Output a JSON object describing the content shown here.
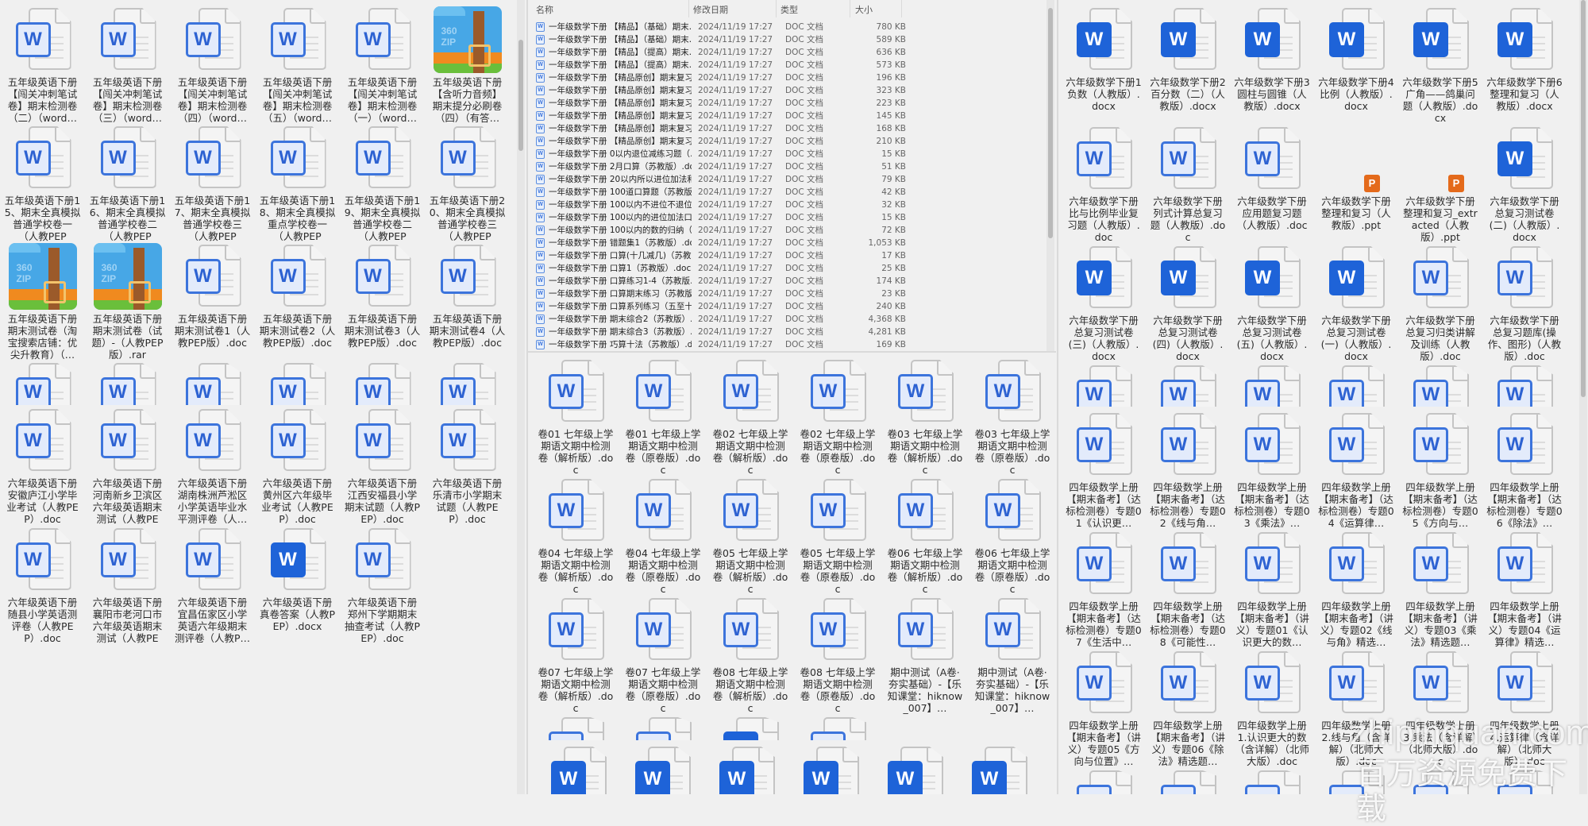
{
  "windows": {
    "left_top": [
      {
        "label": "五年级英语下册【闯关冲刺笔试卷】期末检测卷（二）（word…",
        "icon": "doc"
      },
      {
        "label": "五年级英语下册【闯关冲刺笔试卷】期末检测卷（三）（word…",
        "icon": "doc"
      },
      {
        "label": "五年级英语下册【闯关冲刺笔试卷】期末检测卷（四）（word…",
        "icon": "doc"
      },
      {
        "label": "五年级英语下册【闯关冲刺笔试卷】期末检测卷（五）（word…",
        "icon": "doc"
      },
      {
        "label": "五年级英语下册【闯关冲刺笔试卷】期末检测卷（一）（word…",
        "icon": "doc"
      },
      {
        "label": "五年级英语下册【含听力音频】期末提分必刷卷（四）（有答…",
        "icon": "zip"
      },
      {
        "label": "五年级英语下册15、期末全真模拟普通学校卷一（人教PEP版）…",
        "icon": "doc"
      },
      {
        "label": "五年级英语下册16、期末全真模拟普通学校卷二（人教PEP版）…",
        "icon": "doc"
      },
      {
        "label": "五年级英语下册17、期末全真模拟普通学校卷三（人教PEP版）…",
        "icon": "doc"
      },
      {
        "label": "五年级英语下册18、期末全真模拟重点学校卷一（人教PEP版）…",
        "icon": "doc"
      },
      {
        "label": "五年级英语下册19、期末全真模拟普通学校卷二（人教PEP版）…",
        "icon": "doc"
      },
      {
        "label": "五年级英语下册20、期末全真模拟普通学校卷三（人教PEP版）…",
        "icon": "doc"
      },
      {
        "label": "五年级英语下册期末测试卷（淘宝搜索店铺：优尖升教育）（…",
        "icon": "zip"
      },
      {
        "label": "五年级英语下册期末测试卷（试题）-（人教PEP版）.rar",
        "icon": "zip"
      },
      {
        "label": "五年级英语下册期末测试卷1（人教PEP版）.doc",
        "icon": "doc"
      },
      {
        "label": "五年级英语下册期末测试卷2（人教PEP版）.doc",
        "icon": "doc"
      },
      {
        "label": "五年级英语下册期末测试卷3（人教PEP版）.doc",
        "icon": "doc"
      },
      {
        "label": "五年级英语下册期末测试卷4（人教PEP版）.doc",
        "icon": "doc"
      },
      {
        "label": "",
        "icon": "doc"
      },
      {
        "label": "",
        "icon": "doc"
      },
      {
        "label": "",
        "icon": "doc"
      },
      {
        "label": "",
        "icon": "doc"
      },
      {
        "label": "",
        "icon": "doc"
      },
      {
        "label": "",
        "icon": "doc"
      }
    ],
    "left_bottom": [
      {
        "label": "六年级英语下册安徽庐江小学毕业考试（人教PEP）.doc",
        "icon": "doc"
      },
      {
        "label": "六年级英语下册河南新乡卫滨区六年级英语期末测试（人教PEP…",
        "icon": "doc"
      },
      {
        "label": "六年级英语下册湖南株洲芦淞区小学英语毕业水平测评卷（人…",
        "icon": "doc"
      },
      {
        "label": "六年级英语下册黄州区六年级毕业考试（人教PEP）.doc",
        "icon": "doc"
      },
      {
        "label": "六年级英语下册江西安福县小学期末试题（人教PEP）.doc",
        "icon": "doc"
      },
      {
        "label": "六年级英语下册乐清市小学期末试题（人教PEP）.doc",
        "icon": "doc"
      },
      {
        "label": "六年级英语下册随县小学英语测评卷（人教PEP）.doc",
        "icon": "doc"
      },
      {
        "label": "六年级英语下册襄阳市老河口市六年级英语期末测试（人教PEP…",
        "icon": "doc"
      },
      {
        "label": "六年级英语下册宜昌伍家区小学英语六年级期末测评卷（人教P…",
        "icon": "doc"
      },
      {
        "label": "六年级英语下册真卷答案（人教PEP）.docx",
        "icon": "docx"
      },
      {
        "label": "六年级英语下册郑州下学期期末抽查考试（人教PEP）.doc",
        "icon": "doc"
      }
    ],
    "mid_bottom": [
      {
        "label": "卷01 七年级上学期语文期中检测卷（解析版）.doc",
        "icon": "doc"
      },
      {
        "label": "卷01 七年级上学期语文期中检测卷（原卷版）.doc",
        "icon": "doc"
      },
      {
        "label": "卷02 七年级上学期语文期中检测卷（解析版）.doc",
        "icon": "doc"
      },
      {
        "label": "卷02 七年级上学期语文期中检测卷（原卷版）.doc",
        "icon": "doc"
      },
      {
        "label": "卷03 七年级上学期语文期中检测卷（解析版）.doc",
        "icon": "doc"
      },
      {
        "label": "卷03 七年级上学期语文期中检测卷（原卷版）.doc",
        "icon": "doc"
      },
      {
        "label": "卷04 七年级上学期语文期中检测卷（解析版）.doc",
        "icon": "doc"
      },
      {
        "label": "卷04 七年级上学期语文期中检测卷（原卷版）.doc",
        "icon": "doc"
      },
      {
        "label": "卷05 七年级上学期语文期中检测卷（解析版）.doc",
        "icon": "doc"
      },
      {
        "label": "卷05 七年级上学期语文期中检测卷（原卷版）.doc",
        "icon": "doc"
      },
      {
        "label": "卷06 七年级上学期语文期中检测卷（解析版）.doc",
        "icon": "doc"
      },
      {
        "label": "卷06 七年级上学期语文期中检测卷（原卷版）.doc",
        "icon": "doc"
      },
      {
        "label": "卷07 七年级上学期语文期中检测卷（解析版）.doc",
        "icon": "doc"
      },
      {
        "label": "卷07 七年级上学期语文期中检测卷（原卷版）.doc",
        "icon": "doc"
      },
      {
        "label": "卷08 七年级上学期语文期中检测卷（解析版）.doc",
        "icon": "doc"
      },
      {
        "label": "卷08 七年级上学期语文期中检测卷（原卷版）.doc",
        "icon": "doc"
      },
      {
        "label": "期中测试（A卷·夯实基础）-【乐知课堂：hiknow_007】…",
        "icon": "doc"
      },
      {
        "label": "期中测试（A卷·夯实基础）-【乐知课堂：hiknow_007】…",
        "icon": "doc"
      },
      {
        "label": "",
        "icon": "doc"
      },
      {
        "label": "",
        "icon": "doc"
      },
      {
        "label": "",
        "icon": "docx"
      },
      {
        "label": "",
        "icon": "doc"
      }
    ],
    "mid_bottom2": [
      {
        "label": "",
        "icon": "docx"
      },
      {
        "label": "",
        "icon": "docx"
      },
      {
        "label": "",
        "icon": "docx"
      },
      {
        "label": "",
        "icon": "docx"
      },
      {
        "label": "",
        "icon": "docx"
      },
      {
        "label": "",
        "icon": "docx"
      }
    ],
    "right_top": [
      {
        "label": "六年级数学下册1 负数（人教版）.docx",
        "icon": "docx"
      },
      {
        "label": "六年级数学下册2 百分数（二）（人教版）.docx",
        "icon": "docx"
      },
      {
        "label": "六年级数学下册3 圆柱与圆锥（人教版）.docx",
        "icon": "docx"
      },
      {
        "label": "六年级数学下册4 比例（人教版）.docx",
        "icon": "docx"
      },
      {
        "label": "六年级数学下册5 广角——鸽巢问题（人教版）.docx",
        "icon": "docx"
      },
      {
        "label": "六年级数学下册6 整理和复习（人教版）.docx",
        "icon": "docx"
      },
      {
        "label": "六年级数学下册比与比例毕业复习题（人教版）.doc",
        "icon": "doc"
      },
      {
        "label": "六年级数学下册列式计算总复习题（人教版）.doc",
        "icon": "doc"
      },
      {
        "label": "六年级数学下册应用题复习题（人教版）.doc",
        "icon": "doc"
      },
      {
        "label": "六年级数学下册整理和复习（人教版）.ppt",
        "icon": "ppt"
      },
      {
        "label": "六年级数学下册整理和复习_extracted（人教版）.ppt",
        "icon": "ppt"
      },
      {
        "label": "六年级数学下册总复习测试卷(二)（人教版）.docx",
        "icon": "docx"
      },
      {
        "label": "六年级数学下册总复习测试卷(三)（人教版）.docx",
        "icon": "docx"
      },
      {
        "label": "六年级数学下册总复习测试卷(四)（人教版）.docx",
        "icon": "docx"
      },
      {
        "label": "六年级数学下册总复习测试卷(五)（人教版）.docx",
        "icon": "docx"
      },
      {
        "label": "六年级数学下册总复习测试卷(一)（人教版）.docx",
        "icon": "docx"
      },
      {
        "label": "六年级数学下册总复习归类讲解及训练（人教版）.doc",
        "icon": "doc"
      },
      {
        "label": "六年级数学下册总复习题库(操作、图形)（人教版）.doc",
        "icon": "doc"
      },
      {
        "label": "",
        "icon": "doc"
      },
      {
        "label": "",
        "icon": "doc"
      },
      {
        "label": "",
        "icon": "doc"
      },
      {
        "label": "",
        "icon": "doc"
      },
      {
        "label": "",
        "icon": "doc"
      },
      {
        "label": "",
        "icon": "doc"
      }
    ],
    "right_bottom": [
      {
        "label": "四年级数学上册【期末备考】（达标检测卷）专题01《认识更…",
        "icon": "doc"
      },
      {
        "label": "四年级数学上册【期末备考】（达标检测卷）专题02《线与角…",
        "icon": "doc"
      },
      {
        "label": "四年级数学上册【期末备考】（达标检测卷）专题03《乘法》…",
        "icon": "doc"
      },
      {
        "label": "四年级数学上册【期末备考】（达标检测卷）专题04《运算律…",
        "icon": "doc"
      },
      {
        "label": "四年级数学上册【期末备考】（达标检测卷）专题05《方向与…",
        "icon": "doc"
      },
      {
        "label": "四年级数学上册【期末备考】（达标检测卷）专题06《除法》…",
        "icon": "doc"
      },
      {
        "label": "四年级数学上册【期末备考】（达标检测卷）专题07《生活中…",
        "icon": "doc"
      },
      {
        "label": "四年级数学上册【期末备考】（达标检测卷）专题08《可能性…",
        "icon": "doc"
      },
      {
        "label": "四年级数学上册【期末备考】（讲义）专题01《认识更大的数…",
        "icon": "doc"
      },
      {
        "label": "四年级数学上册【期末备考】（讲义）专题02《线与角》精选…",
        "icon": "doc"
      },
      {
        "label": "四年级数学上册【期末备考】（讲义）专题03《乘法》精选题…",
        "icon": "doc"
      },
      {
        "label": "四年级数学上册【期末备考】（讲义）专题04《运算律》精选…",
        "icon": "doc"
      },
      {
        "label": "四年级数学上册【期末备考】（讲义）专题05《方向与位置》…",
        "icon": "doc"
      },
      {
        "label": "四年级数学上册【期末备考】（讲义）专题06《除法》精选题…",
        "icon": "doc"
      },
      {
        "label": "四年级数学上册1.认识更大的数（含详解）（北师大版）.doc",
        "icon": "doc"
      },
      {
        "label": "四年级数学上册2.线与角（含详解）（北师大版）.doc",
        "icon": "doc"
      },
      {
        "label": "四年级数学上册3.乘法（含详解）（北师大版）.doc",
        "icon": "doc"
      },
      {
        "label": "四年级数学上册4.运算律（含详解）（北师大版）.doc",
        "icon": "doc"
      },
      {
        "label": "",
        "icon": "doc"
      },
      {
        "label": "",
        "icon": "doc"
      },
      {
        "label": "",
        "icon": "doc"
      },
      {
        "label": "",
        "icon": "doc"
      },
      {
        "label": "",
        "icon": "doc"
      },
      {
        "label": "",
        "icon": "doc"
      }
    ]
  },
  "list": {
    "headers": {
      "name": "名称",
      "date": "修改日期",
      "type": "类型",
      "size": "大小"
    },
    "rows": [
      {
        "name": "一年级数学下册 【精品】（基础）期末…",
        "date": "2024/11/19 17:27",
        "type": "DOC 文档",
        "size": "780 KB"
      },
      {
        "name": "一年级数学下册 【精品】（基础）期末…",
        "date": "2024/11/19 17:27",
        "type": "DOC 文档",
        "size": "589 KB"
      },
      {
        "name": "一年级数学下册 【精品】（提高）期末…",
        "date": "2024/11/19 17:27",
        "type": "DOC 文档",
        "size": "636 KB"
      },
      {
        "name": "一年级数学下册 【精品】（提高）期末…",
        "date": "2024/11/19 17:27",
        "type": "DOC 文档",
        "size": "573 KB"
      },
      {
        "name": "一年级数学下册 【精品原创】期末复习…",
        "date": "2024/11/19 17:27",
        "type": "DOC 文档",
        "size": "196 KB"
      },
      {
        "name": "一年级数学下册 【精品原创】期末复习…",
        "date": "2024/11/19 17:27",
        "type": "DOC 文档",
        "size": "323 KB"
      },
      {
        "name": "一年级数学下册 【精品原创】期末复习…",
        "date": "2024/11/19 17:27",
        "type": "DOC 文档",
        "size": "223 KB"
      },
      {
        "name": "一年级数学下册 【精品原创】期末复习…",
        "date": "2024/11/19 17:27",
        "type": "DOC 文档",
        "size": "145 KB"
      },
      {
        "name": "一年级数学下册 【精品原创】期末复习…",
        "date": "2024/11/19 17:27",
        "type": "DOC 文档",
        "size": "168 KB"
      },
      {
        "name": "一年级数学下册 【精品原创】期末复习…",
        "date": "2024/11/19 17:27",
        "type": "DOC 文档",
        "size": "210 KB"
      },
      {
        "name": "一年级数学下册 0以内退位减练习题（…",
        "date": "2024/11/19 17:27",
        "type": "DOC 文档",
        "size": "15 KB"
      },
      {
        "name": "一年级数学下册 2月口算（苏教版）.doc",
        "date": "2024/11/19 17:27",
        "type": "DOC 文档",
        "size": "51 KB"
      },
      {
        "name": "一年级数学下册 20以内所以进位加法和…",
        "date": "2024/11/19 17:27",
        "type": "DOC 文档",
        "size": "79 KB"
      },
      {
        "name": "一年级数学下册 100道口算题（苏教版…",
        "date": "2024/11/19 17:27",
        "type": "DOC 文档",
        "size": "42 KB"
      },
      {
        "name": "一年级数学下册 100以内不进位不退位…",
        "date": "2024/11/19 17:27",
        "type": "DOC 文档",
        "size": "32 KB"
      },
      {
        "name": "一年级数学下册 100以内的进位加法口…",
        "date": "2024/11/19 17:27",
        "type": "DOC 文档",
        "size": "15 KB"
      },
      {
        "name": "一年级数学下册 100以内的数的归纳（…",
        "date": "2024/11/19 17:27",
        "type": "DOC 文档",
        "size": "72 KB"
      },
      {
        "name": "一年级数学下册 错题集1（苏教版）.doc",
        "date": "2024/11/19 17:27",
        "type": "DOC 文档",
        "size": "1,053 KB"
      },
      {
        "name": "一年级数学下册 口算(十几减几)（苏教…",
        "date": "2024/11/19 17:27",
        "type": "DOC 文档",
        "size": "17 KB"
      },
      {
        "name": "一年级数学下册 口算1（苏教版）.doc",
        "date": "2024/11/19 17:27",
        "type": "DOC 文档",
        "size": "25 KB"
      },
      {
        "name": "一年级数学下册 口算练习1-4（苏教版…",
        "date": "2024/11/19 17:27",
        "type": "DOC 文档",
        "size": "174 KB"
      },
      {
        "name": "一年级数学下册 口算期末练习（苏教版…",
        "date": "2024/11/19 17:27",
        "type": "DOC 文档",
        "size": "23 KB"
      },
      {
        "name": "一年级数学下册 口算系列练习（五至十…",
        "date": "2024/11/19 17:27",
        "type": "DOC 文档",
        "size": "240 KB"
      },
      {
        "name": "一年级数学下册 期末综合2（苏教版）.…",
        "date": "2024/11/19 17:27",
        "type": "DOC 文档",
        "size": "4,368 KB"
      },
      {
        "name": "一年级数学下册 期末综合3（苏教版）.…",
        "date": "2024/11/19 17:27",
        "type": "DOC 文档",
        "size": "4,281 KB"
      },
      {
        "name": "一年级数学下册 巧算十法（苏教版）.doc",
        "date": "2024/11/19 17:27",
        "type": "DOC 文档",
        "size": "169 KB"
      }
    ]
  },
  "watermark": {
    "domain": "zhipinquan.com",
    "slogan": "百万资源免费下载"
  },
  "colors": {
    "background": "#f0f0f0",
    "word_blue": "#3c74dc",
    "docx_blue": "#1e63d8",
    "ppt_orange": "#e46a1b"
  }
}
